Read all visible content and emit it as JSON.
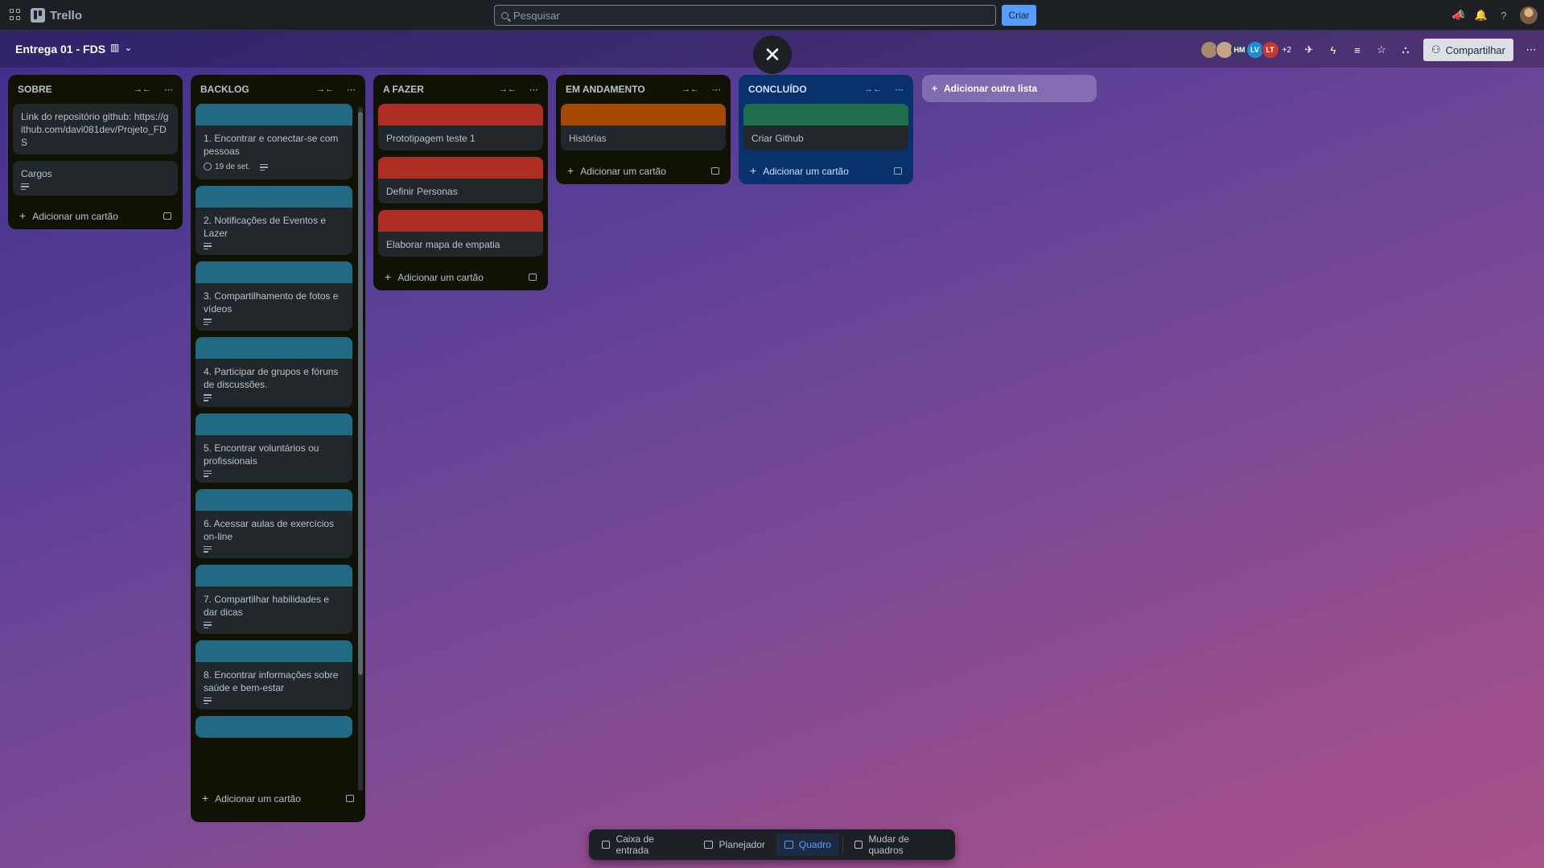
{
  "app": {
    "name": "Trello"
  },
  "search": {
    "placeholder": "Pesquisar"
  },
  "topbar": {
    "create_label": "Criar"
  },
  "board": {
    "title": "Entrega 01 - FDS",
    "members": [
      {
        "initials": "",
        "color": "#a78a6a"
      },
      {
        "initials": "",
        "color": "#c4a484"
      },
      {
        "initials": "HM",
        "color": "#3d3b66"
      },
      {
        "initials": "LV",
        "color": "#1e8fd6"
      },
      {
        "initials": "LT",
        "color": "#c9372c"
      }
    ],
    "extra_members": "+2",
    "share_label": "Compartilhar"
  },
  "lists": [
    {
      "title": "SOBRE",
      "cards": [
        {
          "title": "Link do repositório github: https://github.com/davi081dev/Projeto_FDS"
        },
        {
          "title": "Cargos"
        }
      ],
      "add_label": "Adicionar um cartão"
    },
    {
      "title": "BACKLOG",
      "cover_color": "#206a83",
      "cards": [
        {
          "title": "1. Encontrar e conectar-se com pessoas",
          "due": "19 de set."
        },
        {
          "title": "2. Notificações de Eventos e Lazer"
        },
        {
          "title": "3. Compartilhamento de fotos e vídeos"
        },
        {
          "title": "4. Participar de grupos e fóruns de discussões."
        },
        {
          "title": "5. Encontrar voluntários ou profissionais"
        },
        {
          "title": "6. Acessar aulas de exercícios on-line"
        },
        {
          "title": "7. Compartilhar habilidades e dar dicas"
        },
        {
          "title": "8. Encontrar informações sobre saúde e bem-estar"
        }
      ],
      "add_label": "Adicionar um cartão"
    },
    {
      "title": "A FAZER",
      "cover_color": "#ae2e24",
      "cards": [
        {
          "title": "Prototipagem teste 1"
        },
        {
          "title": "Definir Personas"
        },
        {
          "title": "Elaborar mapa de empatia"
        }
      ],
      "add_label": "Adicionar um cartão"
    },
    {
      "title": "EM ANDAMENTO",
      "cover_color": "#a54800",
      "cards": [
        {
          "title": "Histórias"
        }
      ],
      "add_label": "Adicionar um cartão"
    },
    {
      "title": "CONCLUÍDO",
      "cover_color": "#216e4e",
      "cards": [
        {
          "title": "Criar Github"
        }
      ],
      "add_label": "Adicionar um cartão"
    }
  ],
  "add_list_label": "Adicionar outra lista",
  "bottom_nav": {
    "inbox": "Caixa de entrada",
    "planner": "Planejador",
    "board": "Quadro",
    "switch": "Mudar de quadros"
  }
}
